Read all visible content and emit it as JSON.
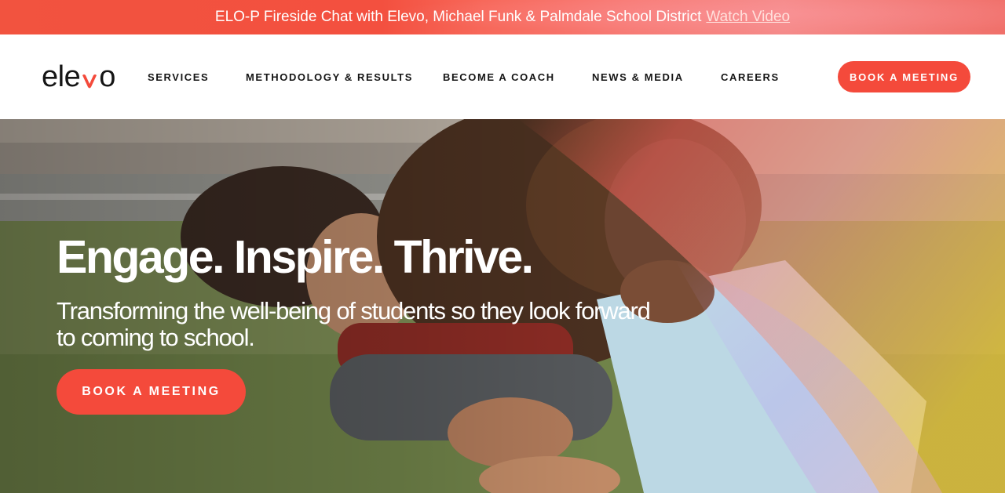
{
  "announcement": {
    "text": "ELO-P Fireside Chat with Elevo, Michael Funk & Palmdale School District",
    "link_label": "Watch Video"
  },
  "logo": {
    "prefix": "ele",
    "suffix": "o",
    "accent_color": "#f44a3b"
  },
  "nav": {
    "items": [
      {
        "label": "SERVICES"
      },
      {
        "label": "METHODOLOGY & RESULTS"
      },
      {
        "label": "BECOME A COACH"
      },
      {
        "label": "NEWS & MEDIA"
      },
      {
        "label": "CAREERS"
      }
    ],
    "cta_label": "BOOK A MEETING"
  },
  "hero": {
    "title": "Engage. Inspire. Thrive.",
    "subtitle": "Transforming the well-being of students so they look forward to coming to school.",
    "cta_label": "BOOK A MEETING",
    "image_icon": "photo-two-students-laughing-on-grass"
  },
  "colors": {
    "brand": "#f44a3b",
    "announcement_bg": "#f3503f",
    "text_dark": "#151515"
  }
}
